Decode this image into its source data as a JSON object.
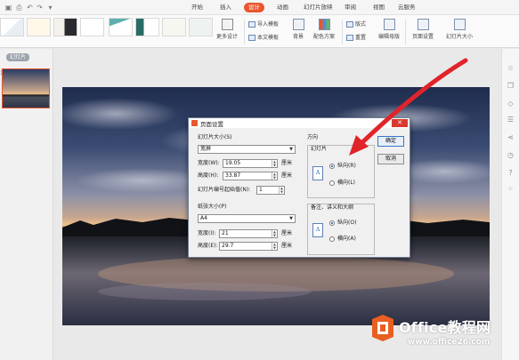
{
  "menu": {
    "tabs": [
      {
        "label": "开始"
      },
      {
        "label": "插入"
      },
      {
        "label": "设计"
      },
      {
        "label": "动画"
      },
      {
        "label": "幻灯片放映"
      },
      {
        "label": "审阅"
      },
      {
        "label": "视图"
      },
      {
        "label": "云服务"
      }
    ],
    "active_tab": "设计"
  },
  "ribbon": {
    "more_designs": "更多设计",
    "import_template": "导入模板",
    "text_template": "本文模板",
    "background": "背景",
    "color_scheme": "配色方案",
    "format": "版式",
    "reset": "重置",
    "edit_master": "编辑母版",
    "page_setup": "页面设置",
    "slide_size": "幻灯片大小"
  },
  "left_pane": {
    "label": "幻灯片",
    "slide_number": "1"
  },
  "dialog": {
    "title": "页面设置",
    "slide_size_label": "幻灯片大小(S)",
    "slide_size_value": "宽屏",
    "width_label": "宽度(W):",
    "width_value": "19.05",
    "height_label": "高度(H):",
    "height_value": "33.87",
    "unit": "厘米",
    "numbering_label": "幻灯片编号起始值(N):",
    "numbering_value": "1",
    "paper_size_label": "纸张大小(P)",
    "paper_size_value": "A4",
    "paper_width_label": "宽度(I):",
    "paper_width_value": "21",
    "paper_height_label": "高度(E):",
    "paper_height_value": "29.7",
    "orientation_label": "方向",
    "slides_label": "幻灯片",
    "portrait": "纵向(R)",
    "landscape": "横向(L)",
    "notes_label": "备注、讲义和大纲",
    "notes_portrait": "纵向(O)",
    "notes_landscape": "横向(A)",
    "ok": "确定",
    "cancel": "取消",
    "slides_orientation_selected": "portrait",
    "notes_orientation_selected": "portrait"
  },
  "watermark": {
    "brand": "Office教程网",
    "url": "www.office26.com"
  },
  "colors": {
    "accent": "#e8572e",
    "arrow": "#e0242a"
  }
}
